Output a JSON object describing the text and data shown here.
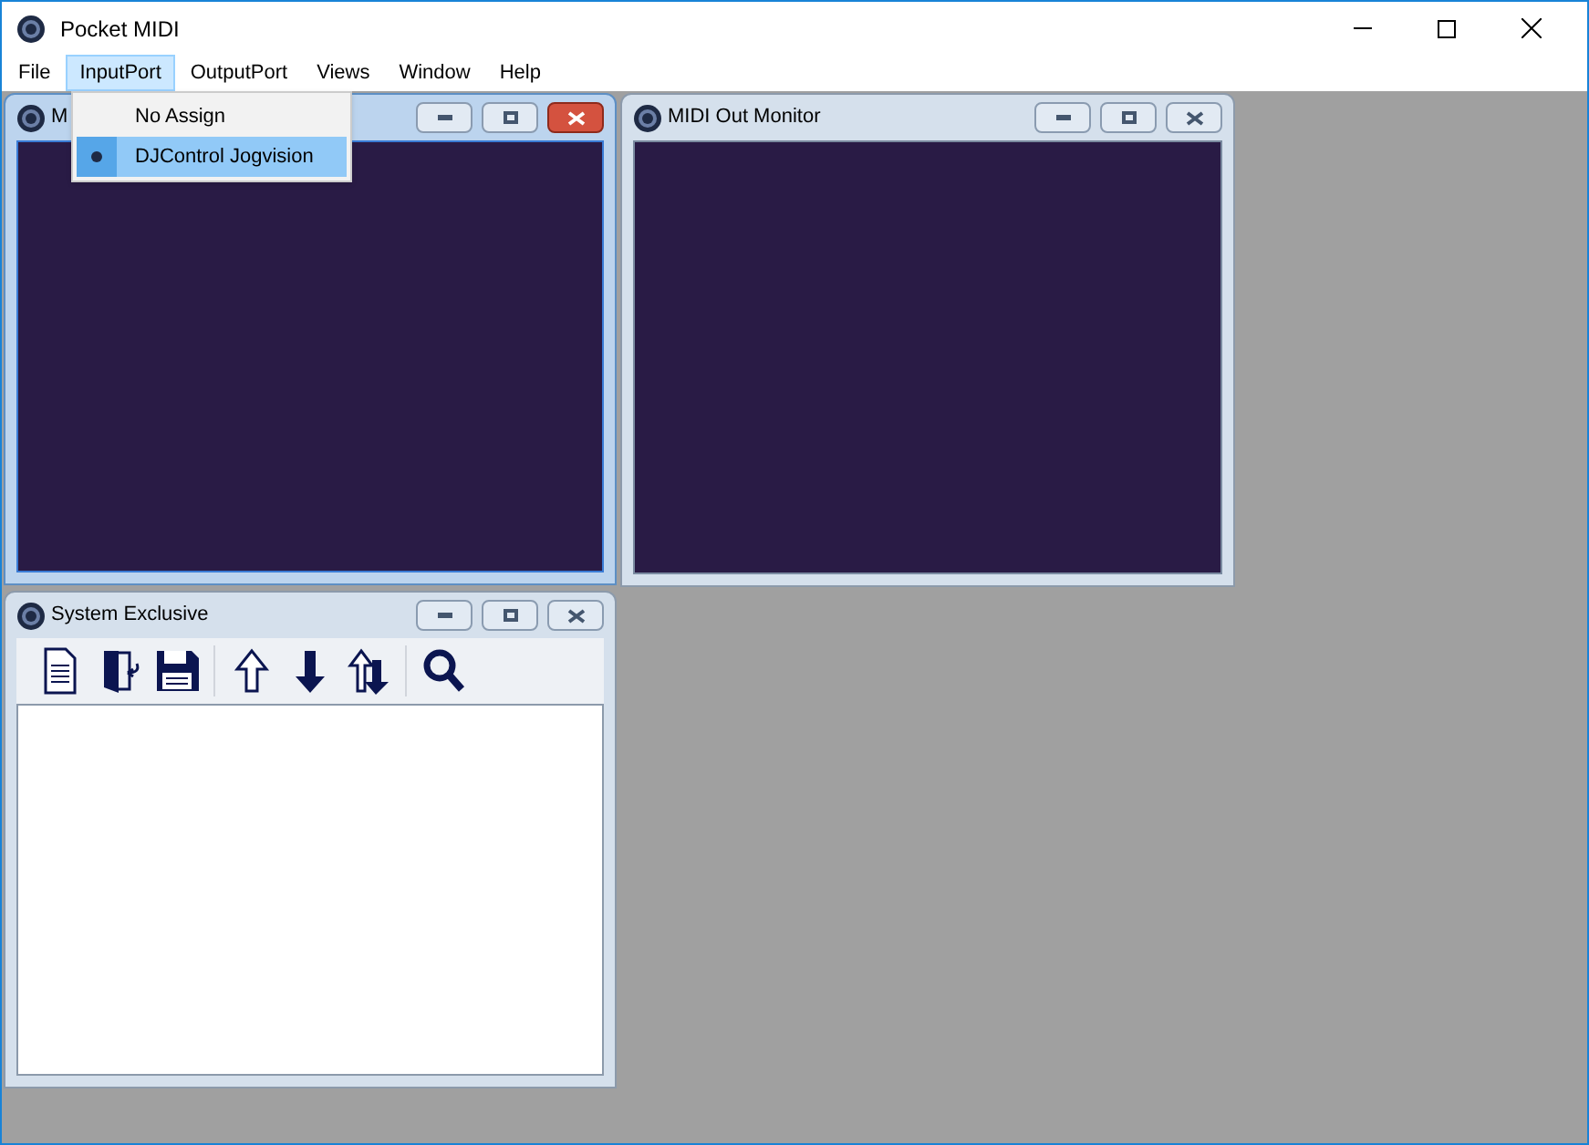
{
  "window": {
    "title": "Pocket MIDI"
  },
  "menu": [
    {
      "label": "File",
      "selected": false
    },
    {
      "label": "InputPort",
      "selected": true
    },
    {
      "label": "OutputPort",
      "selected": false
    },
    {
      "label": "Views",
      "selected": false
    },
    {
      "label": "Window",
      "selected": false
    },
    {
      "label": "Help",
      "selected": false
    }
  ],
  "dropdown": {
    "items": [
      {
        "label": "No Assign",
        "checked": false,
        "selected": false
      },
      {
        "label": "DJControl Jogvision",
        "checked": true,
        "selected": true
      }
    ]
  },
  "child_windows": [
    {
      "title": "M",
      "active": true,
      "kind": "monitor"
    },
    {
      "title": "MIDI Out Monitor",
      "active": false,
      "kind": "monitor"
    },
    {
      "title": "System Exclusive",
      "active": false,
      "kind": "sysex"
    }
  ]
}
